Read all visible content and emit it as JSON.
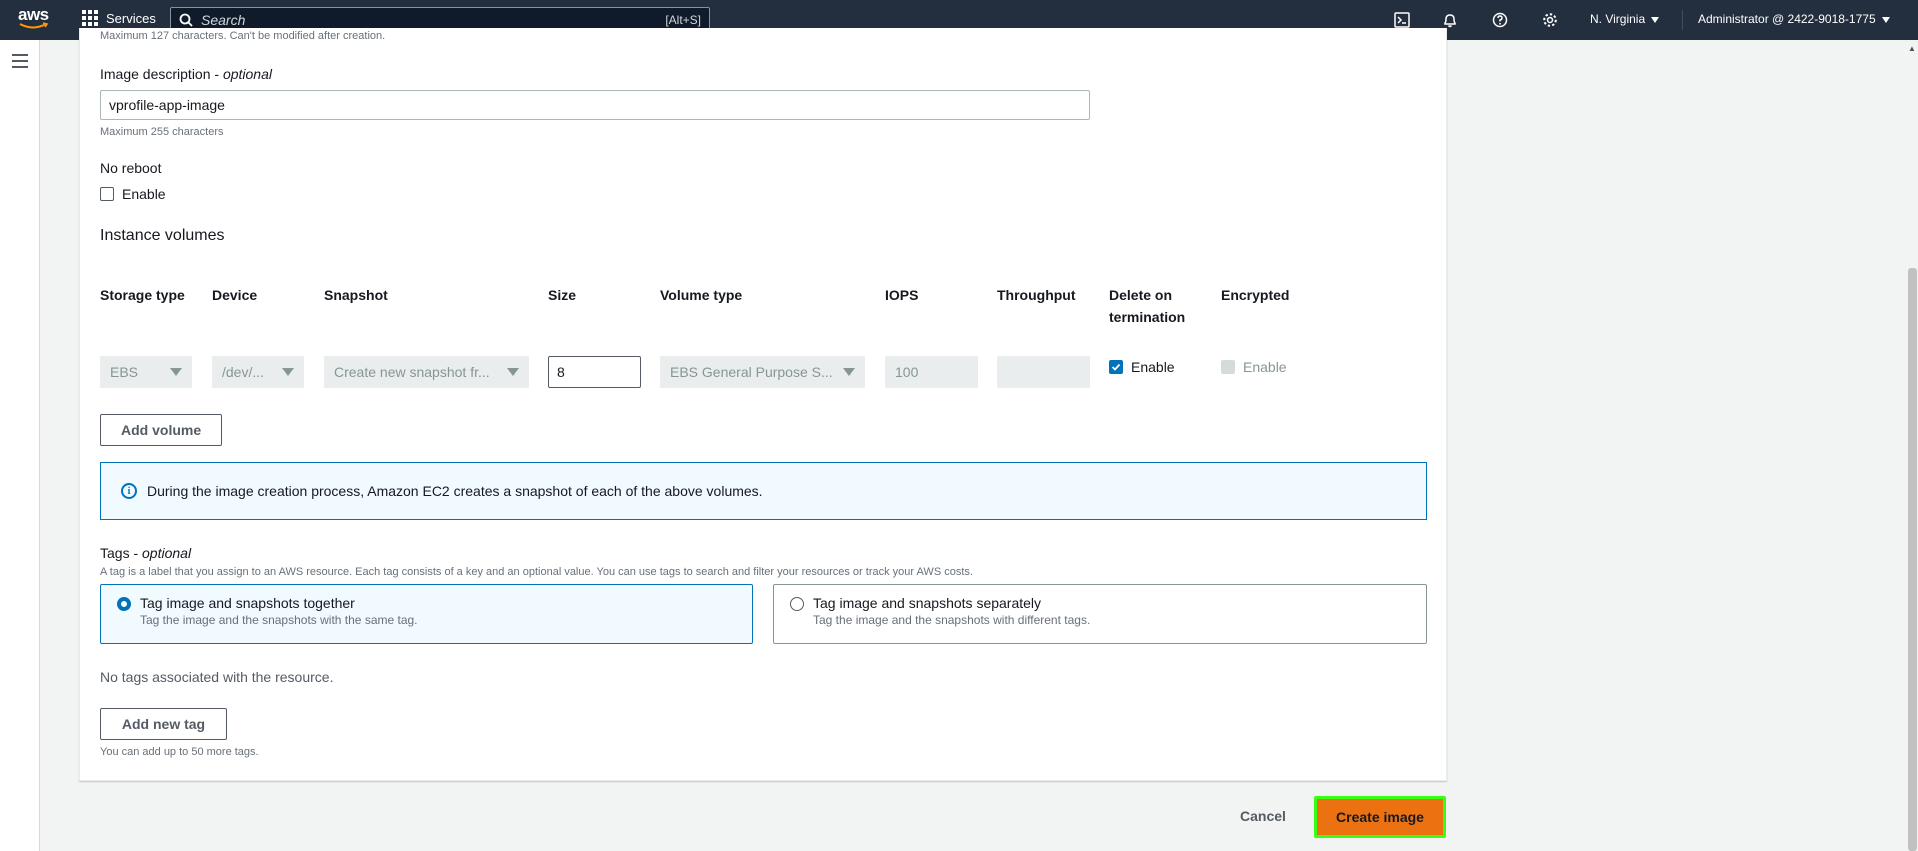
{
  "topnav": {
    "logo_text": "aws",
    "services_label": "Services",
    "search_placeholder": "Search",
    "search_shortcut": "[Alt+S]",
    "region": "N. Virginia",
    "account": "Administrator @ 2422-9018-1775"
  },
  "form": {
    "clipped_hint": "Maximum 127 characters. Can't be modified after creation.",
    "image_description_label": "Image description - ",
    "optional_label": "optional",
    "image_description_value": "vprofile-app-image",
    "image_description_hint": "Maximum 255 characters",
    "no_reboot_label": "No reboot",
    "no_reboot_enable": "Enable",
    "instance_volumes_title": "Instance volumes",
    "columns": {
      "storage_type": "Storage type",
      "device": "Device",
      "snapshot": "Snapshot",
      "size": "Size",
      "volume_type": "Volume type",
      "iops": "IOPS",
      "throughput": "Throughput",
      "delete_on_termination": "Delete on termination",
      "encrypted": "Encrypted"
    },
    "volume_row": {
      "storage_type": "EBS",
      "device": "/dev/...",
      "snapshot": "Create new snapshot fr...",
      "size": "8",
      "volume_type": "EBS General Purpose S...",
      "iops": "100",
      "throughput": "",
      "delete_on_termination_label": "Enable",
      "delete_on_termination_checked": true,
      "encrypted_label": "Enable",
      "encrypted_checked": false
    },
    "add_volume_button": "Add volume",
    "info_text": "During the image creation process, Amazon EC2 creates a snapshot of each of the above volumes.",
    "tags_label": "Tags - ",
    "tags_optional": "optional",
    "tags_description": "A tag is a label that you assign to an AWS resource. Each tag consists of a key and an optional value. You can use tags to search and filter your resources or track your AWS costs.",
    "tag_options": [
      {
        "title": "Tag image and snapshots together",
        "description": "Tag the image and the snapshots with the same tag.",
        "selected": true
      },
      {
        "title": "Tag image and snapshots separately",
        "description": "Tag the image and the snapshots with different tags.",
        "selected": false
      }
    ],
    "no_tags_text": "No tags associated with the resource.",
    "add_tag_button": "Add new tag",
    "tags_limit_hint": "You can add up to 50 more tags."
  },
  "footer": {
    "cancel_label": "Cancel",
    "create_label": "Create image"
  },
  "colors": {
    "nav_bg": "#232f3e",
    "accent_blue": "#0073bb",
    "primary_orange": "#ec7211",
    "highlight_green": "#39ff14"
  }
}
